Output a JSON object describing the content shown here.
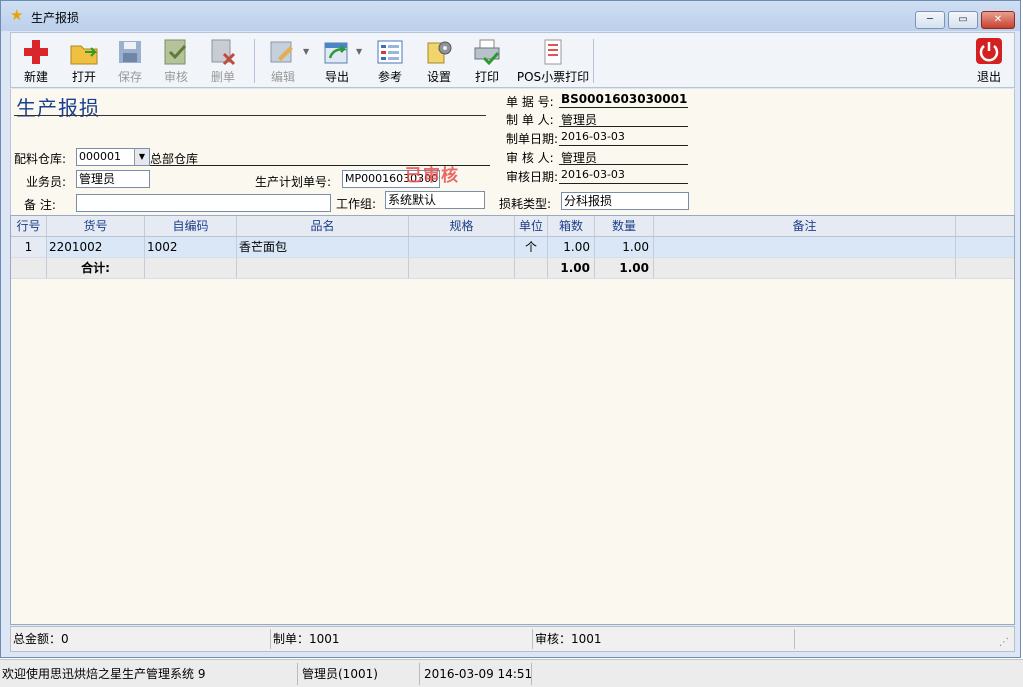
{
  "window": {
    "title": "生产报损"
  },
  "toolbar": {
    "new": "新建",
    "open": "打开",
    "save": "保存",
    "audit": "审核",
    "delete": "删单",
    "edit": "编辑",
    "export": "导出",
    "reference": "参考",
    "settings": "设置",
    "print": "打印",
    "pos_print": "POS小票打印",
    "exit": "退出"
  },
  "form": {
    "heading": "生产报损",
    "doc_no_label": "单 据 号:",
    "doc_no": "BS0001603030001",
    "maker_label": "制 单 人:",
    "maker": "管理员",
    "make_date_label": "制单日期:",
    "make_date": "2016-03-03",
    "auditor_label": "审 核 人:",
    "auditor": "管理员",
    "audit_date_label": "审核日期:",
    "audit_date": "2016-03-03",
    "warehouse_label": "配料仓库:",
    "warehouse_code": "000001",
    "warehouse_name": "总部仓库",
    "salesman_label": "业务员:",
    "salesman": "管理员",
    "plan_no_label": "生产计划单号:",
    "plan_no": "MP0001603030001",
    "stamp": "已审核",
    "remark_label": "备  注:",
    "remark": "",
    "workgroup_label": "工作组:",
    "workgroup": "系统默认",
    "loss_type_label": "损耗类型:",
    "loss_type": "分科报损"
  },
  "grid": {
    "headers": [
      "行号",
      "货号",
      "自编码",
      "品名",
      "规格",
      "单位",
      "箱数",
      "数量",
      "备注"
    ],
    "rows": [
      {
        "line": "1",
        "code": "2201002",
        "self_code": "1002",
        "name": "香芒面包",
        "spec": "",
        "unit": "个",
        "boxes": "1.00",
        "qty": "1.00",
        "note": ""
      }
    ],
    "total": {
      "label": "合计:",
      "boxes": "1.00",
      "qty": "1.00"
    }
  },
  "status": {
    "total_amount": "总金额：0",
    "maker": "制单：1001",
    "auditor": "审核：1001"
  },
  "taskbar": {
    "welcome": "欢迎使用思迅烘焙之星生产管理系统 9",
    "user": "管理员(1001)",
    "datetime": "2016-03-09 14:51"
  },
  "colors": {
    "heading": "#1b3f8c",
    "stamp": "#e4524d",
    "selected_row": "#d9e7f7",
    "form_bg": "#fbf9ef"
  }
}
